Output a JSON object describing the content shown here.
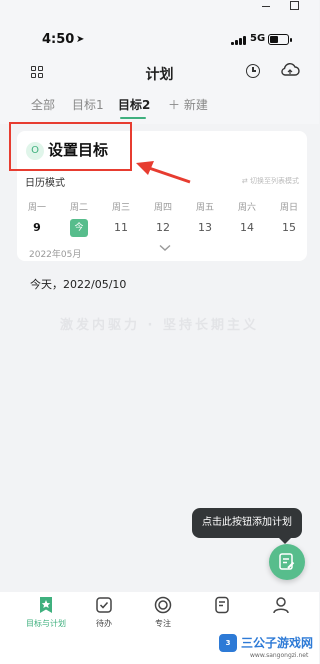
{
  "status_bar": {
    "time": "4:50",
    "network": "5G"
  },
  "header": {
    "title": "计划"
  },
  "tabs": [
    {
      "label": "全部",
      "active": false
    },
    {
      "label": "目标1",
      "active": false
    },
    {
      "label": "目标2",
      "active": true
    },
    {
      "label": "＋ 新建",
      "active": false
    }
  ],
  "goal_card": {
    "circle_letter": "O",
    "title": "设置目标",
    "mode_label": "日历模式",
    "switch_label": "⇄ 切换至列表模式",
    "weekdays": [
      "周一",
      "周二",
      "周三",
      "周四",
      "周五",
      "周六",
      "周日"
    ],
    "dates": [
      "9",
      "今",
      "11",
      "12",
      "13",
      "14",
      "15"
    ],
    "month": "2022年05月"
  },
  "today_line": "今天，2022/05/10",
  "slogan": "激发内驱力 · 坚持长期主义",
  "tooltip": "点击此按钮添加计划",
  "bottom_nav": [
    {
      "label": "目标与计划",
      "icon": "star-book-icon",
      "active": true
    },
    {
      "label": "待办",
      "icon": "check-box-icon",
      "active": false
    },
    {
      "label": "专注",
      "icon": "focus-ring-icon",
      "active": false
    },
    {
      "label": "",
      "icon": "note-icon",
      "active": false
    },
    {
      "label": "",
      "icon": "profile-icon",
      "active": false
    }
  ],
  "watermark": {
    "logo": "3",
    "title": "三公子游戏网",
    "url": "www.sangongzi.net"
  },
  "colors": {
    "accent": "#3fb07e",
    "annotation": "#e73c30",
    "tooltip_bg": "#333638"
  }
}
